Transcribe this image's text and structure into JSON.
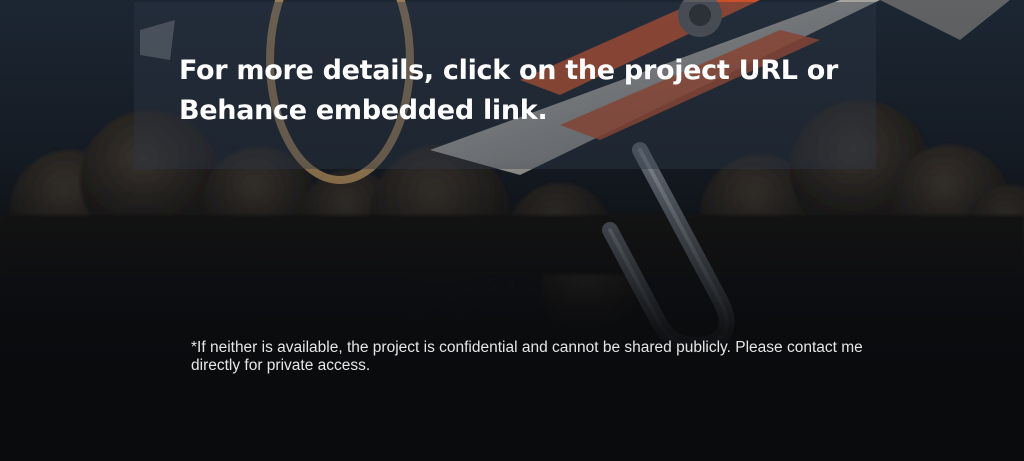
{
  "content": {
    "headline": "For more details, click on the project URL or Behance embedded link.",
    "footnote": "*If neither is available, the project is confidential and cannot be shared publicly. Please contact me directly for private access."
  },
  "colors": {
    "background": "#0b0c0e",
    "text": "#ffffff",
    "accent": "#c8502a"
  },
  "icons": [
    "airplane-illustration",
    "cloud-illustration",
    "paperclip-illustration"
  ]
}
